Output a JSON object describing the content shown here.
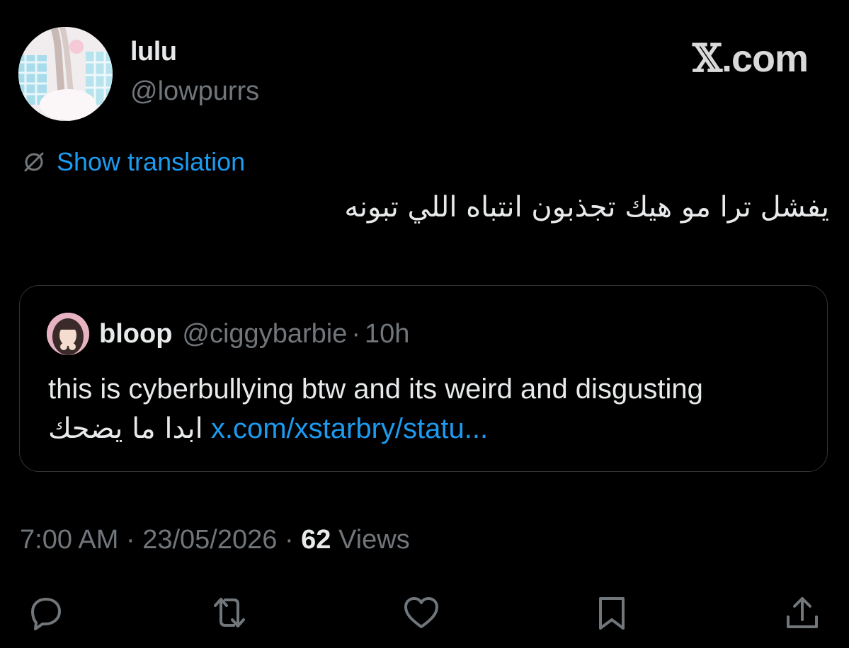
{
  "author": {
    "display_name": "lulu",
    "handle": "@lowpurrs"
  },
  "watermark": "X.com",
  "watermark_x": "𝕏",
  "watermark_suffix": ".com",
  "translate": {
    "label": "Show translation",
    "icon": "globe-slash-icon"
  },
  "tweet": {
    "text": "يفشل ترا مو هيك تجذبون انتباه اللي تبونه"
  },
  "quoted_tweet": {
    "display_name": "bloop",
    "handle": "@ciggybarbie",
    "separator": "·",
    "time": "10h",
    "text_line1": "this is cyberbullying btw and its weird and disgusting",
    "text_arabic": "ابدا ما يضحك",
    "link": "x.com/xstarbry/statu..."
  },
  "meta": {
    "time": "7:00 AM",
    "separator": "·",
    "date": "23/05/2026",
    "views_count": "62",
    "views_label": "Views"
  },
  "actions": {
    "reply": "reply-icon",
    "retweet": "retweet-icon",
    "like": "heart-icon",
    "bookmark": "bookmark-icon",
    "share": "share-icon"
  },
  "colors": {
    "background": "#000000",
    "text_primary": "#e7e9ea",
    "text_secondary": "#71767b",
    "link": "#1d9bf0",
    "border": "#2f3336"
  }
}
